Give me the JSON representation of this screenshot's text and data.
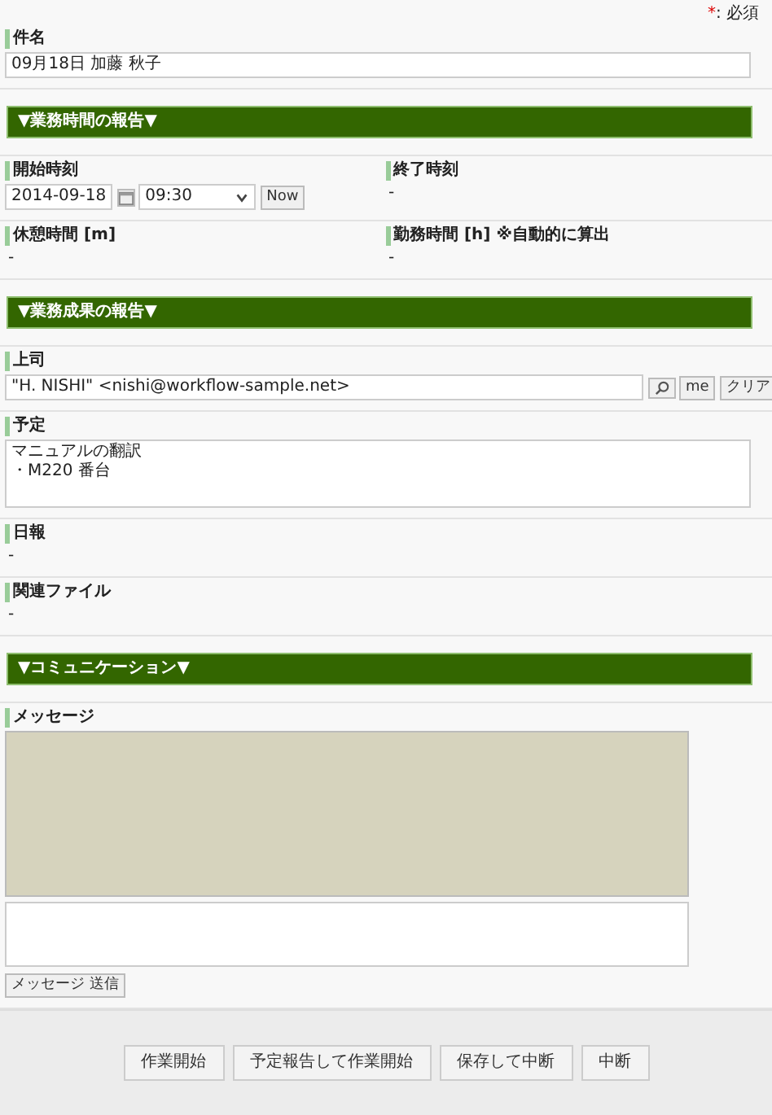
{
  "required_note": {
    "mark": "*",
    "text": ": 必須"
  },
  "sections": [
    {
      "kind": "fields",
      "fields": [
        {
          "label": "件名",
          "kind": "input",
          "value": "09月18日 加藤 秋子"
        }
      ]
    },
    {
      "kind": "header",
      "title": "▼業務時間の報告▼"
    },
    {
      "kind": "fields",
      "fields": [
        {
          "label": "開始時刻",
          "kind": "datetime",
          "date": "2014-09-18",
          "time": "09:30",
          "button": "Now"
        },
        {
          "label": "終了時刻",
          "kind": "text",
          "value": "-"
        }
      ]
    },
    {
      "kind": "fields",
      "fields": [
        {
          "label": "休憩時間 [m]",
          "kind": "text",
          "value": "-"
        },
        {
          "label": "勤務時間 [h] ※自動的に算出",
          "kind": "text",
          "value": "-"
        }
      ]
    },
    {
      "kind": "header",
      "title": "▼業務成果の報告▼"
    },
    {
      "kind": "fields",
      "fields": [
        {
          "label": "上司",
          "kind": "user",
          "value": "\"H. NISHI\" <nishi@workflow-sample.net>",
          "buttons": [
            "me",
            "クリア"
          ]
        }
      ]
    },
    {
      "kind": "fields",
      "fields": [
        {
          "label": "予定",
          "kind": "textarea",
          "lines": [
            "マニュアルの翻訳",
            "・M220 番台"
          ]
        }
      ]
    },
    {
      "kind": "fields",
      "fields": [
        {
          "label": "日報",
          "kind": "text",
          "value": "-"
        }
      ]
    },
    {
      "kind": "fields",
      "fields": [
        {
          "label": "関連ファイル",
          "kind": "text",
          "value": "-"
        }
      ]
    },
    {
      "kind": "header",
      "title": "▼コミュニケーション▼"
    },
    {
      "kind": "fields",
      "fields": [
        {
          "label": "メッセージ",
          "kind": "chat",
          "button": "メッセージ 送信"
        }
      ]
    }
  ],
  "footer_buttons": [
    "作業開始",
    "予定報告して作業開始",
    "保存して中断",
    "中断"
  ]
}
